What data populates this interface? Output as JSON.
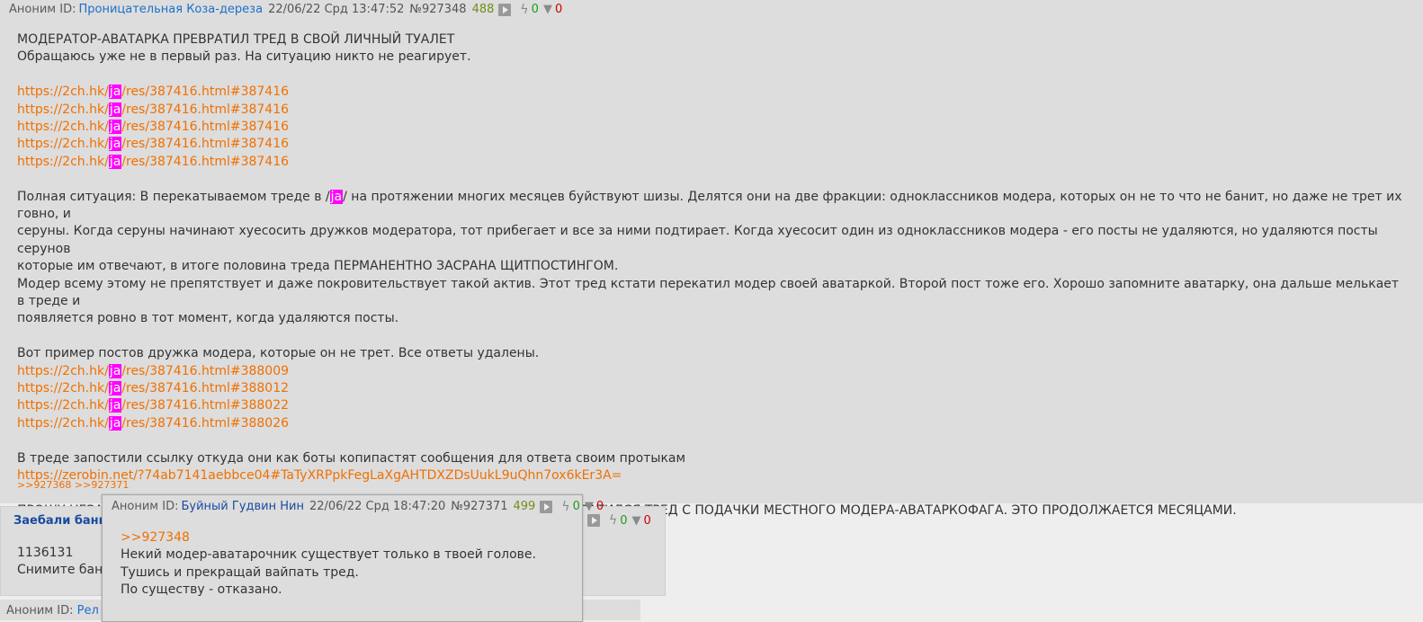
{
  "main_post": {
    "author": "Аноним",
    "id_label": "ID:",
    "poster_id": "Проницательная Коза-дереза",
    "date": "22/06/22 Срд 13:47:52",
    "number": "№927348",
    "counter": "488",
    "likes": "0",
    "dislikes": "0",
    "lines": {
      "l1": "МОДЕРАТОР-АВАТАРКА ПРЕВРАТИЛ ТРЕД В СВОЙ ЛИЧНЫЙ ТУАЛЕТ",
      "l2": "Обращаюсь уже не в первый раз. На ситуацию никто не реагирует.",
      "p1": "Полная ситуация: В перекатываемом треде в /",
      "p1b": "/ на протяжении многих месяцев буйствуют шизы. Делятся они на две фракции: одноклассников модера, которых он не то что не банит, но даже не трет их говно, и",
      "p2": "серуны. Когда серуны начинают хуесосить дружков модератора, тот прибегает и все за ними подтирает. Когда хуесосит один из одноклассников модера - его посты не удаляются, но удаляются посты серунов",
      "p3": "которые им отвечают, в итоге половина треда ПЕРМАНЕНТНО ЗАСРАНА ЩИТПОСТИНГОМ.",
      "p4": "Модер всему этому не препятствует и даже покровительствует такой актив. Этот тред кстати перекатил модер своей аватаркой. Второй пост тоже его. Хорошо запомните аватарку, она дальше мелькает в треде и",
      "p5": "появляется ровно в тот момент, когда удаляются посты.",
      "ex": "Вот пример постов дружка модера, которые он не трет. Все ответы удалены.",
      "bot": "В треде запостили ссылку откуда они как боты копипастят сообщения для ответа своим протыкам",
      "zerobin": "https://zerobin.net/?74ab7141aebbce04#TaTyXRPpkFegLaXgAHTDXZDsUukL9uQhn7ox6kEr3A=",
      "final": "ПРОШУ НЕЗАВИСИМОГО МОДЕРАТОРА РАЗОБРАТЬСЯ В ТОМ ГОВНЕ, В КОТОРОЕ ПРЕВРАТИЛСЯ ТРЕД С ПОДАЧКИ МЕСТНОГО МОДЕРА-АВАТАРКОФАГА. ЭТО ПРОДОЛЖАЕТСЯ МЕСЯЦАМИ."
    },
    "link_prefix": "https://2ch.hk/",
    "link_board": "ja",
    "links_a": [
      "/res/387416.html#387416",
      "/res/387416.html#387416",
      "/res/387416.html#387416",
      "/res/387416.html#387416",
      "/res/387416.html#387416"
    ],
    "links_b": [
      "/res/387416.html#388009",
      "/res/387416.html#388012",
      "/res/387416.html#388022",
      "/res/387416.html#388026"
    ],
    "replies": ">>927368 >>927371"
  },
  "post2": {
    "title": "Заебали бани",
    "line1": "1136131",
    "line2": "Снимите бан",
    "likes": "0",
    "dislikes": "0"
  },
  "post3": {
    "author": "Аноним",
    "id_label": "ID:",
    "poster_id": "Рел"
  },
  "popup": {
    "author": "Аноним",
    "id_label": "ID:",
    "poster_id": "Буйный Гудвин Нин",
    "date": "22/06/22 Срд 18:47:20",
    "number": "№927371",
    "counter": "499",
    "likes": "0",
    "dislikes": "0",
    "reply_ref": ">>927348",
    "line1": "Некий модер-аватарочник существует только в твоей голове.",
    "line2": "Тушись и прекращай вайпать тред.",
    "line3": "По существу - отказано."
  },
  "icons": {
    "bolt": "bolt-icon",
    "thumb": "thumbs-down-icon",
    "play": "play-icon"
  },
  "colors": {
    "link": "#f07000",
    "highlight": "#ff00ff",
    "like": "#1f9a1f",
    "dislike": "#d00000",
    "poster_id": "#1e6fc9"
  }
}
